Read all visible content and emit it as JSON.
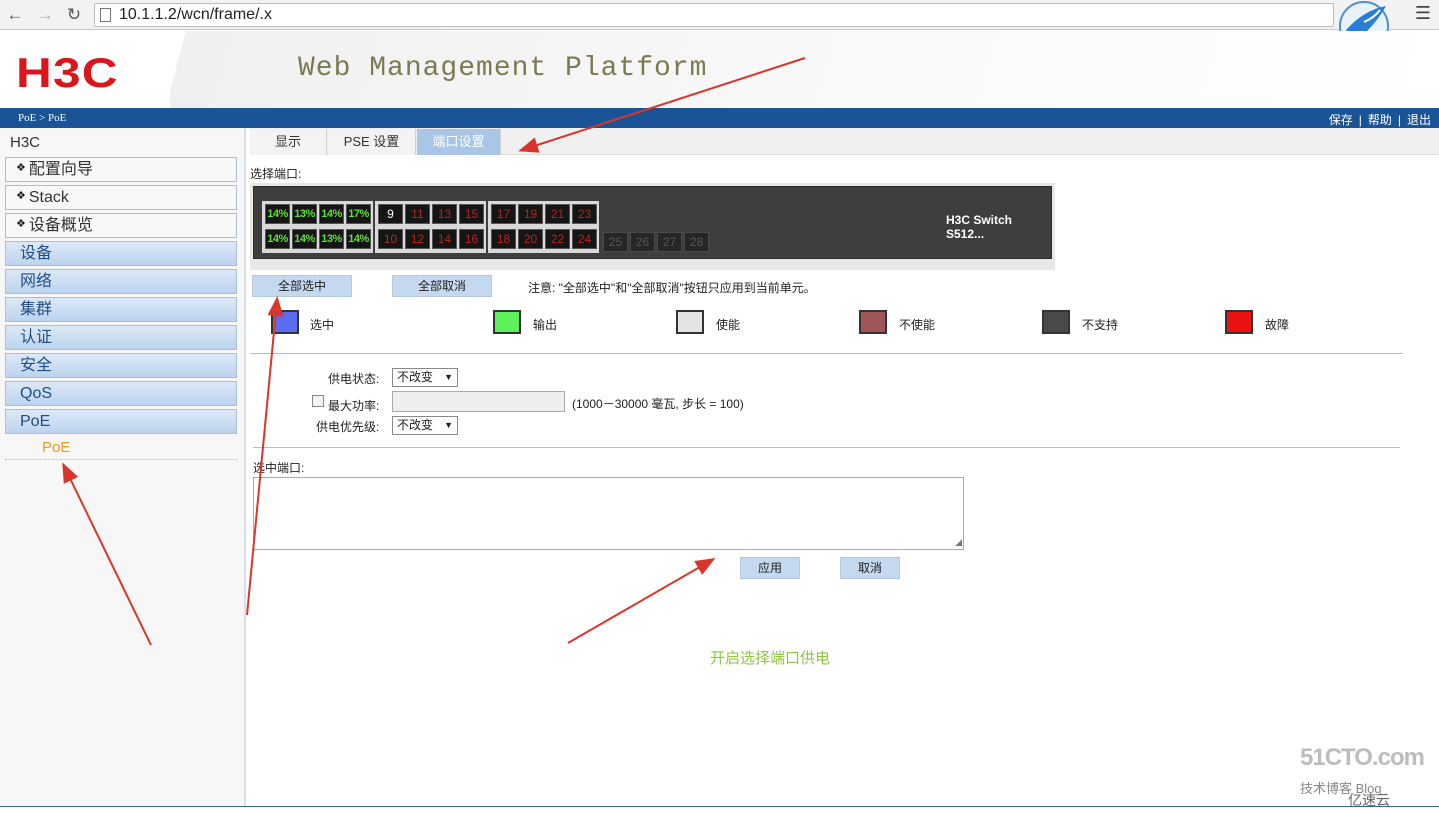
{
  "browser": {
    "url": "10.1.1.2/wcn/frame/.x",
    "back_icon": "back-arrow-icon",
    "forward_icon": "forward-arrow-icon",
    "reload_icon": "reload-icon",
    "menu_icon": "hamburger-menu-icon"
  },
  "header": {
    "logo": "H3C",
    "platform_title": "Web Management Platform"
  },
  "topbar": {
    "breadcrumb": "PoE > PoE",
    "links": [
      "保存",
      "帮助",
      "退出"
    ]
  },
  "sidebar": {
    "title": "H3C",
    "items": [
      "配置向导",
      "Stack",
      "设备概览"
    ],
    "categories": [
      "设备",
      "网络",
      "集群",
      "认证",
      "安全",
      "QoS",
      "PoE"
    ],
    "sub_item": "PoE"
  },
  "tabs": [
    "显示",
    "PSE 设置",
    "端口设置"
  ],
  "active_tab": "端口设置",
  "port_select": {
    "label": "选择端口:",
    "switch_name": "H3C Switch S512...",
    "group1_top": [
      "14%",
      "13%",
      "14%",
      "17%"
    ],
    "group1_bottom": [
      "14%",
      "14%",
      "13%",
      "14%"
    ],
    "group2_top": [
      "9",
      "11",
      "13",
      "15"
    ],
    "group2_bottom": [
      "10",
      "12",
      "14",
      "16"
    ],
    "group3_top": [
      "17",
      "19",
      "21",
      "23"
    ],
    "group3_bottom": [
      "18",
      "20",
      "22",
      "24"
    ],
    "group4": [
      "25",
      "26",
      "27",
      "28"
    ]
  },
  "buttons": {
    "select_all": "全部选中",
    "deselect_all": "全部取消",
    "apply": "应用",
    "cancel": "取消"
  },
  "note": "注意: \"全部选中\"和\"全部取消\"按钮只应用到当前单元。",
  "legend": [
    {
      "label": "选中",
      "color": "#5a6cf0"
    },
    {
      "label": "输出",
      "color": "#5ef05a"
    },
    {
      "label": "使能",
      "color": "#e4e4e4"
    },
    {
      "label": "不使能",
      "color": "#9e5656"
    },
    {
      "label": "不支持",
      "color": "#4a4a4a"
    },
    {
      "label": "故障",
      "color": "#ee1111"
    }
  ],
  "form": {
    "power_state_label": "供电状态:",
    "power_state_value": "不改变",
    "max_power_label": "最大功率:",
    "max_power_range": "(1000－30000 毫瓦, 步长 = 100)",
    "priority_label": "供电优先级:",
    "priority_value": "不改变",
    "selected_ports_label": "选中端口:"
  },
  "caption": "开启选择端口供电",
  "watermark": {
    "line1": "51CTO.com",
    "line2": "技术博客 Blog",
    "line3": "亿速云"
  },
  "colors": {
    "accent_blue": "#1a5496",
    "annotation_red": "#d9362b",
    "caption_green": "#8dc63f",
    "sub_item_orange": "#f39a1e"
  }
}
